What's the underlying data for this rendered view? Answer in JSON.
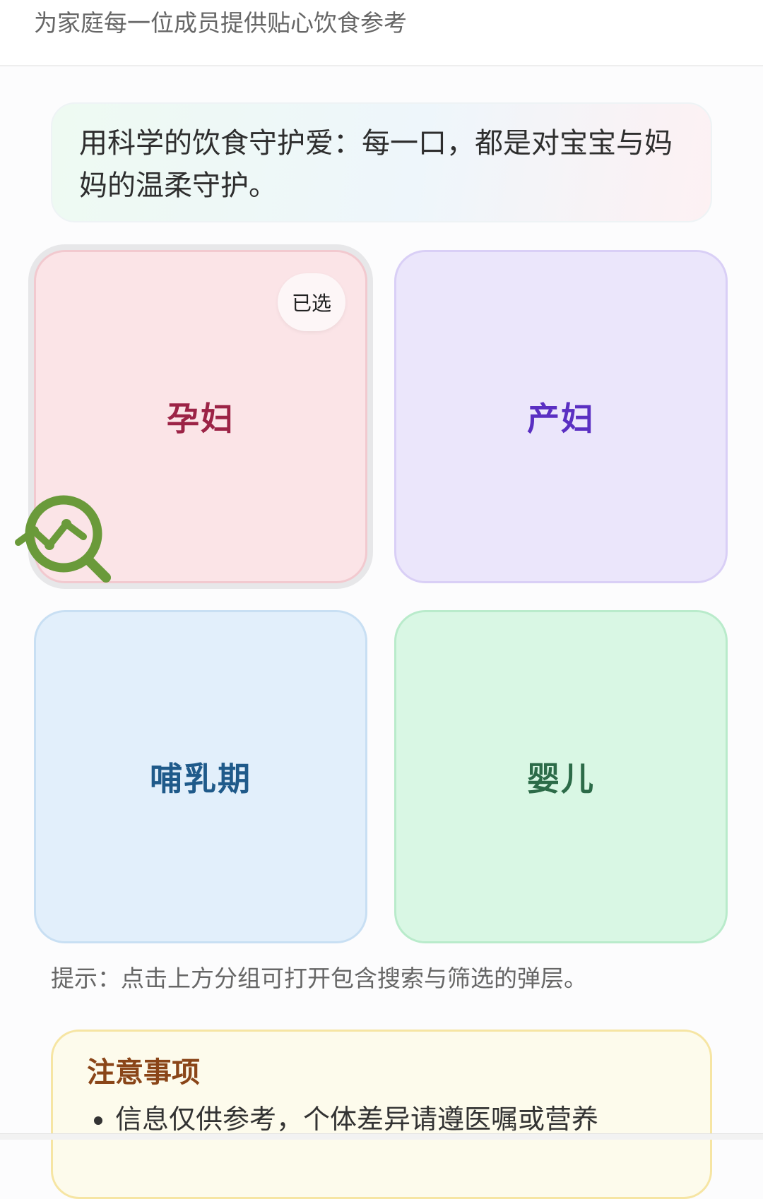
{
  "header": {
    "subtitle": "为家庭每一位成员提供贴心饮食参考"
  },
  "slogan": {
    "text": "用科学的饮食守护爱：每一口，都是对宝宝与妈妈的温柔守护。"
  },
  "groups": [
    {
      "label": "孕妇",
      "selected": true,
      "badge": "已选",
      "color": "#9c2346"
    },
    {
      "label": "产妇",
      "selected": false,
      "color": "#5a2fc2"
    },
    {
      "label": "哺乳期",
      "selected": false,
      "color": "#1f5a8a"
    },
    {
      "label": "婴儿",
      "selected": false,
      "color": "#2c6b48"
    }
  ],
  "tip": {
    "text": "提示：点击上方分组可打开包含搜索与筛选的弹层。"
  },
  "notice": {
    "title": "注意事项",
    "items": [
      "信息仅供参考，个体差异请遵医嘱或营养"
    ]
  },
  "floating_icon": {
    "icon": "trend-search-icon",
    "color": "#6a9a3a"
  }
}
